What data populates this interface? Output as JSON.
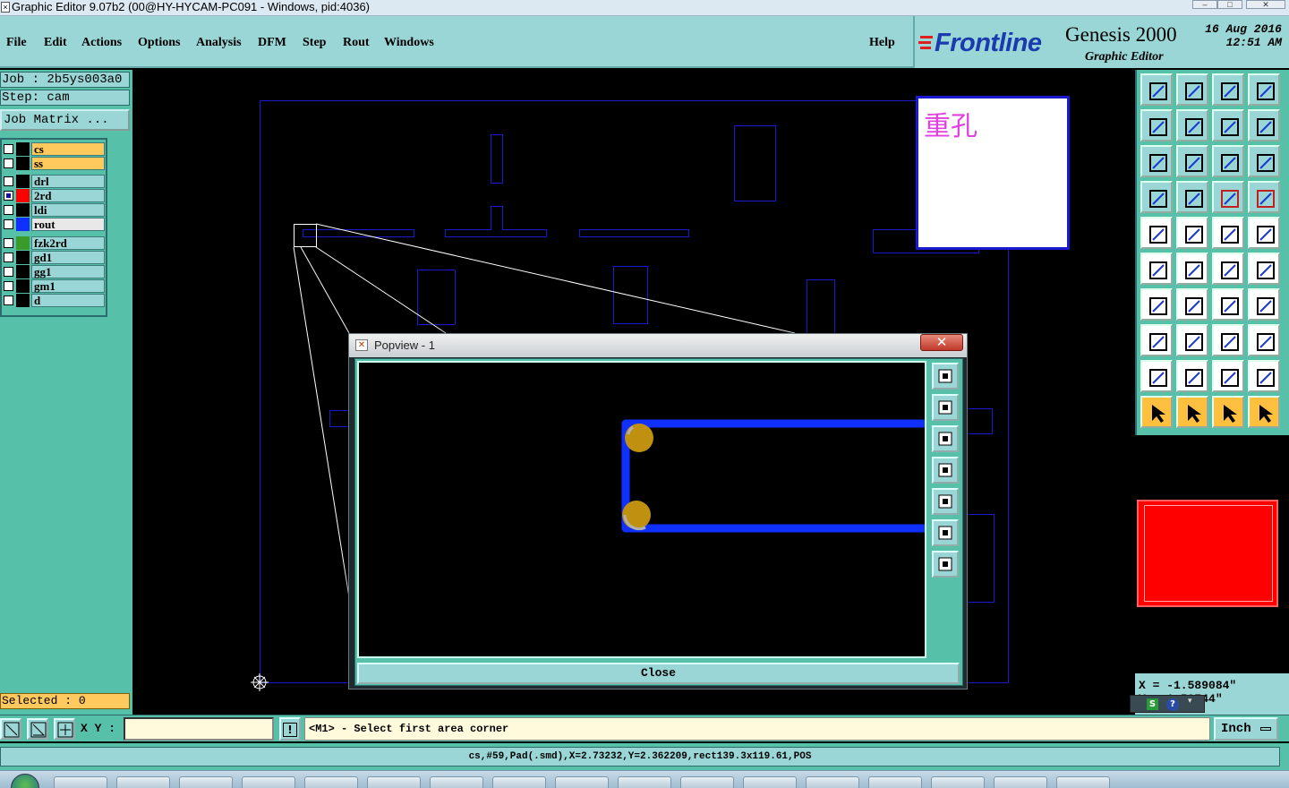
{
  "window": {
    "title": "Graphic Editor 9.07b2 (00@HY-HYCAM-PC091 - Windows, pid:4036)"
  },
  "menu": {
    "items": [
      "File",
      "Edit",
      "Actions",
      "Options",
      "Analysis",
      "DFM",
      "Step",
      "Rout",
      "Windows"
    ],
    "help": "Help"
  },
  "brand": {
    "logo": "Frontline",
    "product": "Genesis 2000",
    "subtitle": "Graphic Editor",
    "date": "16 Aug 2016",
    "time": "12:51 AM"
  },
  "left_panel": {
    "job": "Job : 2b5ys003a0",
    "step": "Step: cam",
    "job_matrix": "Job Matrix ...",
    "layers": [
      {
        "name": "cs",
        "color": "#000000",
        "bg": "#ffc95e",
        "checked": false
      },
      {
        "name": "ss",
        "color": "#000000",
        "bg": "#ffc95e",
        "checked": false
      },
      {
        "name": "drl",
        "color": "#000000",
        "bg": "#9ad6d6",
        "checked": false
      },
      {
        "name": "2rd",
        "color": "#ff0000",
        "bg": "#9ad6d6",
        "checked": true
      },
      {
        "name": "ldi",
        "color": "#000000",
        "bg": "#9ad6d6",
        "checked": false
      },
      {
        "name": "rout",
        "color": "#1030ff",
        "bg": "#e8e8e8",
        "checked": false
      },
      {
        "name": "fzk2rd",
        "color": "#3a9a2a",
        "bg": "#9ad6d6",
        "checked": false
      },
      {
        "name": "gd1",
        "color": "#000000",
        "bg": "#9ad6d6",
        "checked": false
      },
      {
        "name": "gg1",
        "color": "#000000",
        "bg": "#9ad6d6",
        "checked": false
      },
      {
        "name": "gm1",
        "color": "#000000",
        "bg": "#9ad6d6",
        "checked": false
      },
      {
        "name": "d",
        "color": "#000000",
        "bg": "#9ad6d6",
        "checked": false
      }
    ],
    "selected": "Selected : 0"
  },
  "canvas": {
    "legend_text": "重孔"
  },
  "popview": {
    "title": "Popview - 1",
    "close_x": "✕",
    "close_button": "Close",
    "tools": [
      "zoom-window-icon",
      "pan-up-icon",
      "pan-down-icon",
      "pan-left-icon",
      "pan-right-icon",
      "zoom-in-icon",
      "zoom-out-icon"
    ]
  },
  "coords": {
    "x": "X = -1.589084\"",
    "y": "Y =  1.59744\""
  },
  "command": {
    "xy_label": "X Y :",
    "xy_value": "",
    "prompt": "<M1> - Select first area corner",
    "unit": "Inch"
  },
  "status": {
    "text": "cs,#59,Pad(.smd),X=2.73232,Y=2.362209,rect139.3x119.61,POS"
  },
  "colors": {
    "panel_teal": "#56c0a8",
    "panel_light": "#9ad6d6",
    "rout_blue": "#1030ff",
    "pad_gold": "#c09010",
    "legend_magenta": "#e040e0"
  }
}
